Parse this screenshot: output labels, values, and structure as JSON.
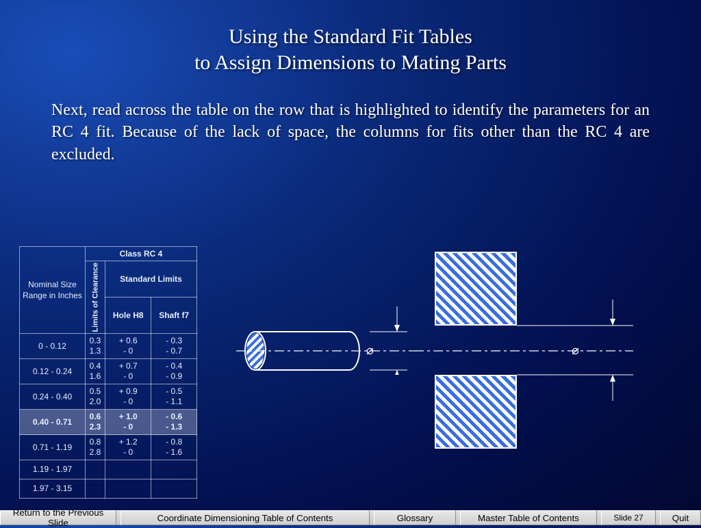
{
  "title": {
    "line1": "Using the Standard Fit Tables",
    "line2": "to Assign Dimensions to Mating Parts"
  },
  "body": "Next, read across the table on the row that is highlighted to identify the parameters for an RC 4 fit.  Because of the lack of space, the columns for fits other than the RC 4 are excluded.",
  "table": {
    "nominal_hdr": "Nominal Size Range in Inches",
    "class_hdr": "Class RC 4",
    "limits_hdr": "Limits of Clearance",
    "std_limits_hdr": "Standard Limits",
    "hole_hdr": "Hole H8",
    "shaft_hdr": "Shaft f7",
    "rows": [
      {
        "range": "0      - 0.12",
        "c1": "0.3",
        "c2": "1.3",
        "h1": "+ 0.6",
        "h2": "- 0",
        "s1": "- 0.3",
        "s2": "- 0.7",
        "hl": false
      },
      {
        "range": "0.12 - 0.24",
        "c1": "0.4",
        "c2": "1.6",
        "h1": "+ 0.7",
        "h2": "- 0",
        "s1": "- 0.4",
        "s2": "- 0.9",
        "hl": false
      },
      {
        "range": "0.24 - 0.40",
        "c1": "0.5",
        "c2": "2.0",
        "h1": "+ 0.9",
        "h2": "- 0",
        "s1": "- 0.5",
        "s2": "- 1.1",
        "hl": false
      },
      {
        "range": "0.40 - 0.71",
        "c1": "0.6",
        "c2": "2.3",
        "h1": "+ 1.0",
        "h2": "- 0",
        "s1": "- 0.6",
        "s2": "- 1.3",
        "hl": true
      },
      {
        "range": "0.71 - 1.19",
        "c1": "0.8",
        "c2": "2.8",
        "h1": "+ 1.2",
        "h2": "- 0",
        "s1": "- 0.8",
        "s2": "- 1.6",
        "hl": false
      },
      {
        "range": "1.19 - 1.97",
        "c1": "",
        "c2": "",
        "h1": "",
        "h2": "",
        "s1": "",
        "s2": "",
        "hl": false
      },
      {
        "range": "1.97 - 3.15",
        "c1": "",
        "c2": "",
        "h1": "",
        "h2": "",
        "s1": "",
        "s2": "",
        "hl": false
      }
    ]
  },
  "diagram": {
    "diameter_symbol": "⌀"
  },
  "footer": {
    "return": "Return to the Previous Slide",
    "coord": "Coordinate Dimensioning Table of Contents",
    "glossary": "Glossary",
    "master": "Master Table of Contents",
    "slide": "Slide 27",
    "quit": "Quit"
  }
}
